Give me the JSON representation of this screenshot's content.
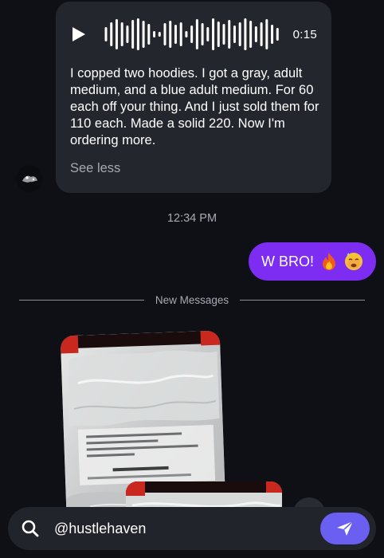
{
  "conversation": {
    "voice_message": {
      "duration": "0:15",
      "transcript": "I copped two hoodies. I got a gray, adult medium, and a blue adult medium. For 60 each off your thing. And I just sold them for 110 each. Made a solid 220. Now I'm ordering more.",
      "toggle_label": "See less"
    },
    "timestamp": "12:34 PM",
    "outgoing_message": {
      "text": "W BRO!",
      "emojis": [
        "fire-emoji",
        "hot-face-emoji"
      ]
    },
    "divider_label": "New Messages"
  },
  "composer": {
    "value": "@hustlehaven",
    "icon": "search-icon",
    "send_icon": "send-icon"
  },
  "colors": {
    "background": "#0e1016",
    "incoming_bubble": "#24262e",
    "outgoing_bubble": "#7d2cf2",
    "send_button": "#6b5ff2",
    "muted_text": "#a8aab3"
  }
}
